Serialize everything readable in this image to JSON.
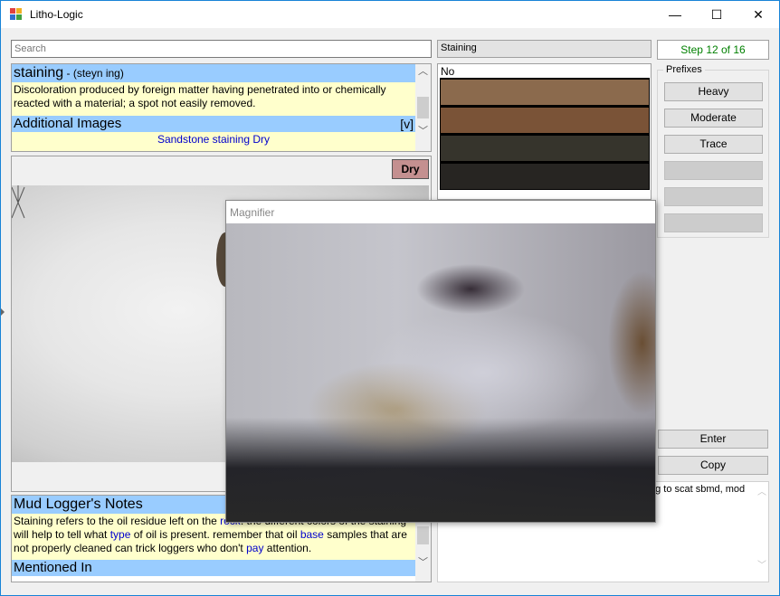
{
  "window": {
    "title": "Litho-Logic",
    "minimize": "—",
    "maximize": "☐",
    "close": "✕"
  },
  "search": {
    "placeholder": "Search"
  },
  "term": {
    "word": "staining",
    "pronunciation": " - (steyn ing)",
    "definition": "Discoloration produced by foreign matter having penetrated into or chemically reacted with a material; a spot not easily removed.",
    "additional_images_label": "Additional Images",
    "expand_label": "[v]",
    "image_link": "Sandstone staining Dry"
  },
  "image_panel": {
    "dry_button": "Dry"
  },
  "notes": {
    "heading": "Mud Logger's Notes",
    "text_parts": [
      {
        "t": "Staining refers to the oil residue left on the ",
        "link": false
      },
      {
        "t": "rock",
        "link": true
      },
      {
        "t": ". the different colors of the staining will help to tell what ",
        "link": false
      },
      {
        "t": "type",
        "link": true
      },
      {
        "t": " of oil is present. remember that oil ",
        "link": false
      },
      {
        "t": "base",
        "link": true
      },
      {
        "t": " samples that are not properly cleaned can trick loggers who don't ",
        "link": false
      },
      {
        "t": "pay",
        "link": true
      },
      {
        "t": " attention.",
        "link": false
      }
    ],
    "mentioned_in": "Mentioned In"
  },
  "category_field": "Staining",
  "step": "Step 12 of 16",
  "swatches": {
    "first_label": "No",
    "colors": [
      "#8b6a4d",
      "#7a5337",
      "#36342c",
      "#272522"
    ]
  },
  "prefixes": {
    "legend": "Prefixes",
    "buttons": [
      "Heavy",
      "Moderate",
      "Trace",
      "",
      "",
      ""
    ]
  },
  "actions": {
    "enter": "Enter",
    "copy": "Copy"
  },
  "result_text": "ng to scat sbmd, mod",
  "magnifier": {
    "title": "Magnifier"
  },
  "colors": {
    "accent": "#99ccff",
    "note_bg": "#ffffcc",
    "step_text": "#008000",
    "dry_button": "#c49090"
  }
}
